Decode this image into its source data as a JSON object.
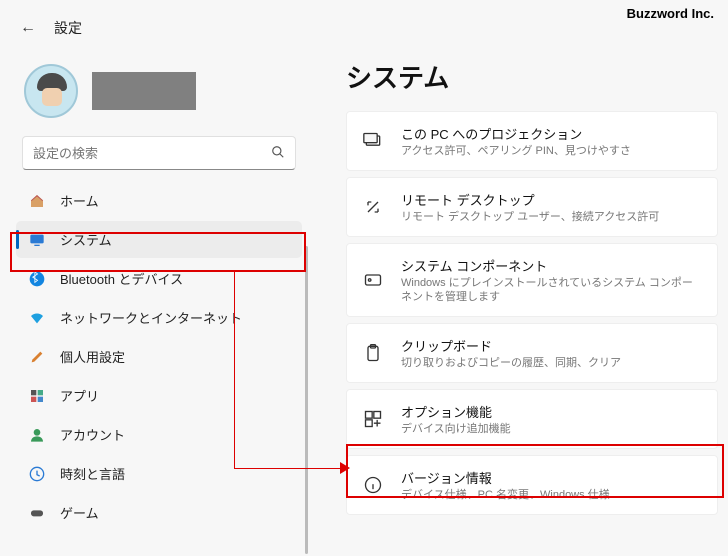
{
  "brand": "Buzzword Inc.",
  "header": {
    "title": "設定"
  },
  "search": {
    "placeholder": "設定の検索"
  },
  "nav": [
    {
      "label": "ホーム"
    },
    {
      "label": "システム"
    },
    {
      "label": "Bluetooth とデバイス"
    },
    {
      "label": "ネットワークとインターネット"
    },
    {
      "label": "個人用設定"
    },
    {
      "label": "アプリ"
    },
    {
      "label": "アカウント"
    },
    {
      "label": "時刻と言語"
    },
    {
      "label": "ゲーム"
    }
  ],
  "main": {
    "title": "システム",
    "cards": [
      {
        "title": "この PC へのプロジェクション",
        "desc": "アクセス許可、ペアリング PIN、見つけやすさ"
      },
      {
        "title": "リモート デスクトップ",
        "desc": "リモート デスクトップ ユーザー、接続アクセス許可"
      },
      {
        "title": "システム コンポーネント",
        "desc": "Windows にプレインストールされているシステム コンポーネントを管理します"
      },
      {
        "title": "クリップボード",
        "desc": "切り取りおよびコピーの履歴、同期、クリア"
      },
      {
        "title": "オプション機能",
        "desc": "デバイス向け追加機能"
      },
      {
        "title": "バージョン情報",
        "desc": "デバイス仕様、PC 名変更、Windows 仕様"
      }
    ]
  }
}
